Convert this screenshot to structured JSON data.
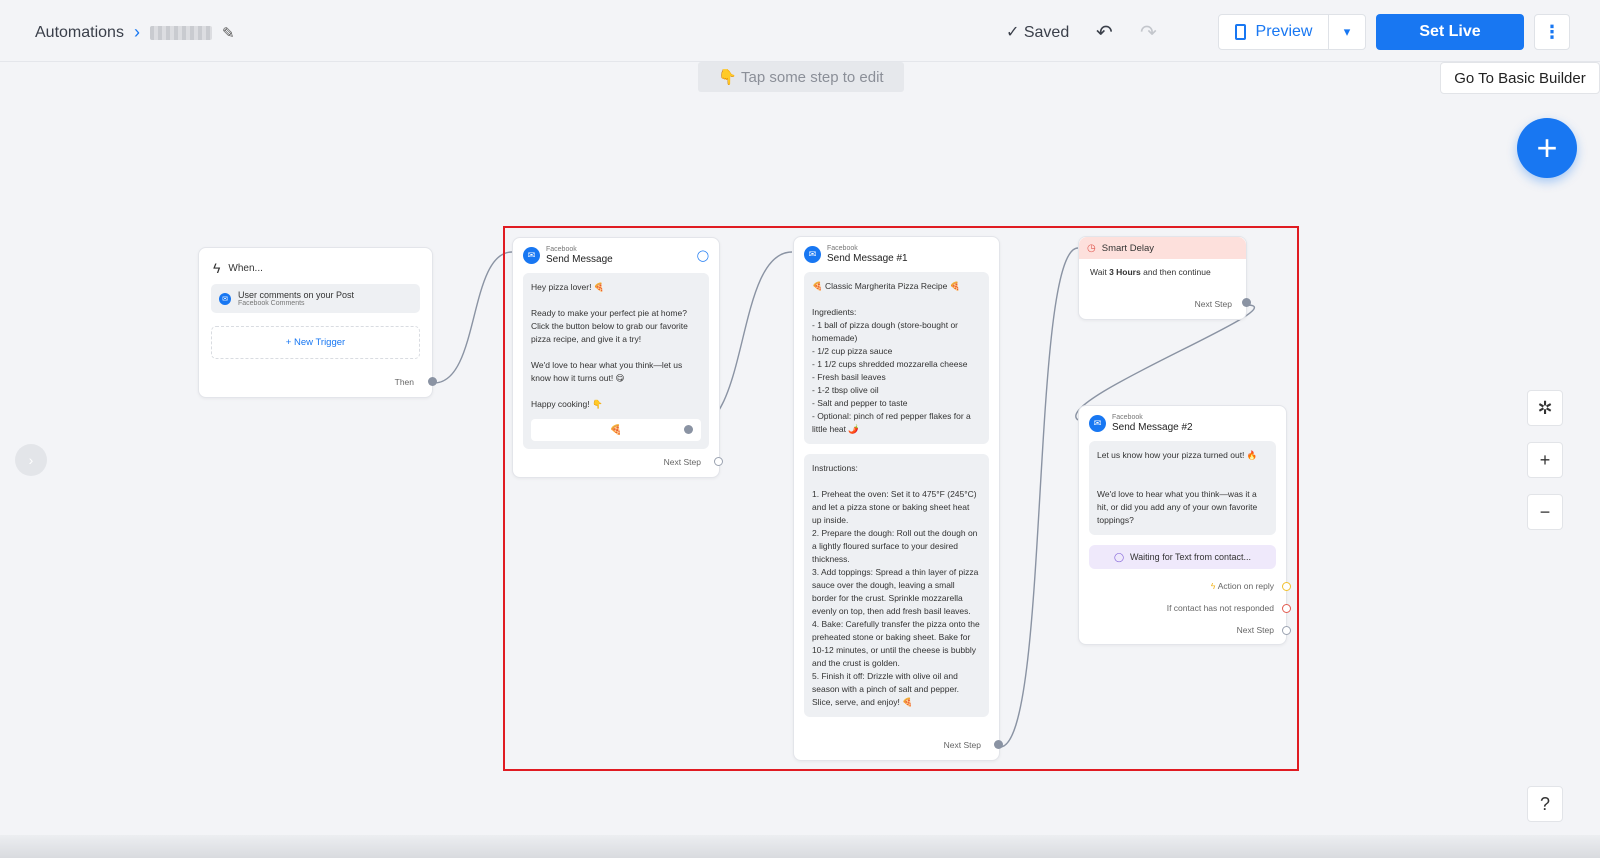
{
  "header": {
    "breadcrumb_root": "Automations",
    "saved_label": "Saved",
    "preview_label": "Preview",
    "set_live_label": "Set Live"
  },
  "canvas": {
    "tap_hint": "👇 Tap some step to edit",
    "basic_builder_label": "Go To Basic Builder"
  },
  "trigger_node": {
    "title": "When...",
    "trigger_label": "User comments on your Post",
    "trigger_sub": "Facebook Comments",
    "new_trigger_label": "+ New Trigger",
    "then_label": "Then"
  },
  "send_message": {
    "platform": "Facebook",
    "title": "Send Message",
    "text": "Hey pizza lover! 🍕\n\nReady to make your perfect pie at home? Click the button below to grab our favorite pizza recipe, and give it a try!\n\nWe'd love to hear what you think—let us know how it turns out! 😋\n\nHappy cooking! 👇",
    "button_label": "🍕",
    "next_step_label": "Next Step"
  },
  "send_message_1": {
    "platform": "Facebook",
    "title": "Send Message #1",
    "ingredients_text": "🍕 Classic Margherita Pizza Recipe 🍕\n\nIngredients:\n- 1 ball of pizza dough (store-bought or homemade)\n- 1/2 cup pizza sauce\n- 1 1/2 cups shredded mozzarella cheese\n- Fresh basil leaves\n- 1-2 tbsp olive oil\n- Salt and pepper to taste\n- Optional: pinch of red pepper flakes for a little heat 🌶️",
    "instructions_text": "Instructions:\n\n1. Preheat the oven: Set it to 475°F (245°C) and let a pizza stone or baking sheet heat up inside.\n2. Prepare the dough: Roll out the dough on a lightly floured surface to your desired thickness.\n3. Add toppings: Spread a thin layer of pizza sauce over the dough, leaving a small border for the crust. Sprinkle mozzarella evenly on top, then add fresh basil leaves.\n4. Bake: Carefully transfer the pizza onto the preheated stone or baking sheet. Bake for 10-12 minutes, or until the cheese is bubbly and the crust is golden.\n5. Finish it off: Drizzle with olive oil and season with a pinch of salt and pepper. Slice, serve, and enjoy! 🍕",
    "next_step_label": "Next Step"
  },
  "smart_delay": {
    "title": "Smart Delay",
    "text_before": "Wait",
    "duration": "3 Hours",
    "text_after": "and then continue",
    "next_step_label": "Next Step"
  },
  "send_message_2": {
    "platform": "Facebook",
    "title": "Send Message #2",
    "text": "Let us know how your pizza turned out! 🔥\n\n\nWe'd love to hear what you think—was it a hit, or did you add any of your own favorite toppings?",
    "waiting_label": "Waiting for Text from contact...",
    "action_on_reply_label": "Action on reply",
    "not_responded_label": "If contact has not responded",
    "next_step_label": "Next Step"
  },
  "colors": {
    "accent": "#1877f2",
    "selection_border": "#e01b22",
    "delay_header": "#fde0dc",
    "waiting_bg": "#efe9fb"
  }
}
